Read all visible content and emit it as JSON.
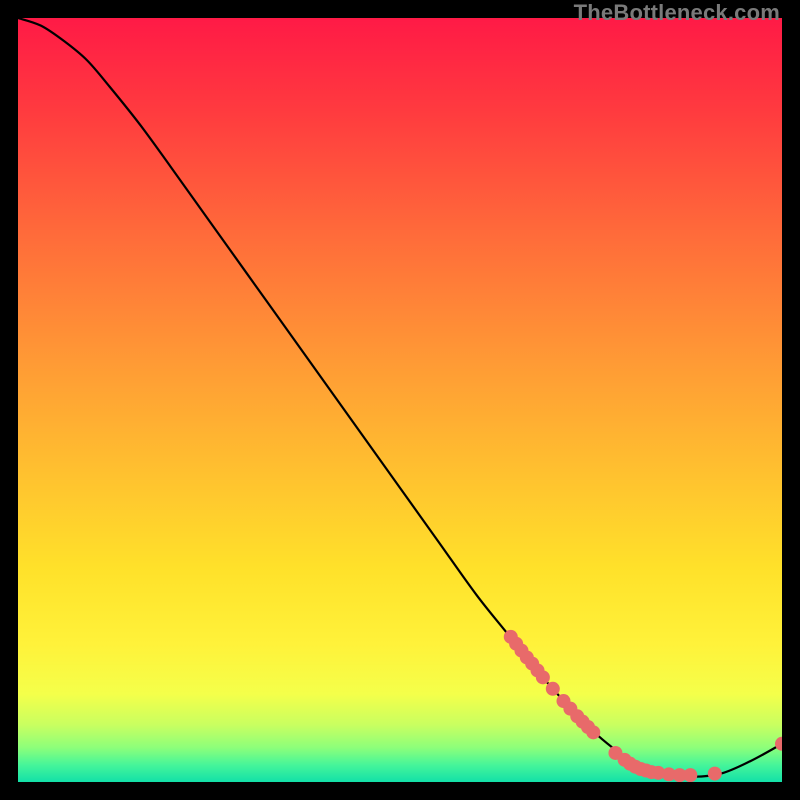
{
  "watermark": "TheBottleneck.com",
  "chart_data": {
    "type": "line",
    "title": "",
    "xlabel": "",
    "ylabel": "",
    "xlim": [
      0,
      100
    ],
    "ylim": [
      0,
      100
    ],
    "grid": false,
    "legend": false,
    "series": [
      {
        "name": "curve",
        "color": "#000000",
        "points": [
          {
            "x": 0,
            "y": 100
          },
          {
            "x": 3,
            "y": 99
          },
          {
            "x": 6,
            "y": 97
          },
          {
            "x": 9,
            "y": 94.5
          },
          {
            "x": 12,
            "y": 91
          },
          {
            "x": 16,
            "y": 86
          },
          {
            "x": 20,
            "y": 80.5
          },
          {
            "x": 25,
            "y": 73.5
          },
          {
            "x": 30,
            "y": 66.5
          },
          {
            "x": 35,
            "y": 59.5
          },
          {
            "x": 40,
            "y": 52.5
          },
          {
            "x": 45,
            "y": 45.5
          },
          {
            "x": 50,
            "y": 38.5
          },
          {
            "x": 55,
            "y": 31.5
          },
          {
            "x": 60,
            "y": 24.5
          },
          {
            "x": 64,
            "y": 19.5
          },
          {
            "x": 68,
            "y": 14.5
          },
          {
            "x": 72,
            "y": 10
          },
          {
            "x": 76,
            "y": 6
          },
          {
            "x": 80,
            "y": 3
          },
          {
            "x": 84,
            "y": 1.3
          },
          {
            "x": 88,
            "y": 0.7
          },
          {
            "x": 92,
            "y": 1.1
          },
          {
            "x": 96,
            "y": 2.8
          },
          {
            "x": 100,
            "y": 5
          }
        ]
      }
    ],
    "scatter": {
      "name": "dots",
      "color": "#e86a6a",
      "radius": 7,
      "points": [
        {
          "x": 64.5,
          "y": 19
        },
        {
          "x": 65.2,
          "y": 18.1
        },
        {
          "x": 65.9,
          "y": 17.2
        },
        {
          "x": 66.6,
          "y": 16.3
        },
        {
          "x": 67.3,
          "y": 15.5
        },
        {
          "x": 68.0,
          "y": 14.6
        },
        {
          "x": 68.7,
          "y": 13.7
        },
        {
          "x": 70.0,
          "y": 12.2
        },
        {
          "x": 71.4,
          "y": 10.6
        },
        {
          "x": 72.3,
          "y": 9.6
        },
        {
          "x": 73.2,
          "y": 8.6
        },
        {
          "x": 73.9,
          "y": 7.9
        },
        {
          "x": 74.6,
          "y": 7.2
        },
        {
          "x": 75.3,
          "y": 6.5
        },
        {
          "x": 78.2,
          "y": 3.8
        },
        {
          "x": 79.4,
          "y": 2.9
        },
        {
          "x": 80.1,
          "y": 2.4
        },
        {
          "x": 80.8,
          "y": 2.0
        },
        {
          "x": 81.5,
          "y": 1.7
        },
        {
          "x": 82.2,
          "y": 1.5
        },
        {
          "x": 82.9,
          "y": 1.3
        },
        {
          "x": 83.8,
          "y": 1.2
        },
        {
          "x": 85.2,
          "y": 1.0
        },
        {
          "x": 86.6,
          "y": 0.9
        },
        {
          "x": 88.0,
          "y": 0.9
        },
        {
          "x": 91.2,
          "y": 1.1
        },
        {
          "x": 100.0,
          "y": 5.0
        }
      ]
    },
    "gradient_stops": [
      {
        "offset": 0.0,
        "color": "#ff1a46"
      },
      {
        "offset": 0.12,
        "color": "#ff3a3f"
      },
      {
        "offset": 0.28,
        "color": "#ff6a3a"
      },
      {
        "offset": 0.45,
        "color": "#ff9a35"
      },
      {
        "offset": 0.6,
        "color": "#ffc22f"
      },
      {
        "offset": 0.72,
        "color": "#ffe12a"
      },
      {
        "offset": 0.82,
        "color": "#fff23a"
      },
      {
        "offset": 0.885,
        "color": "#f4ff4a"
      },
      {
        "offset": 0.925,
        "color": "#c9ff60"
      },
      {
        "offset": 0.955,
        "color": "#8dff7a"
      },
      {
        "offset": 0.978,
        "color": "#45f59a"
      },
      {
        "offset": 1.0,
        "color": "#12e0a8"
      }
    ]
  }
}
